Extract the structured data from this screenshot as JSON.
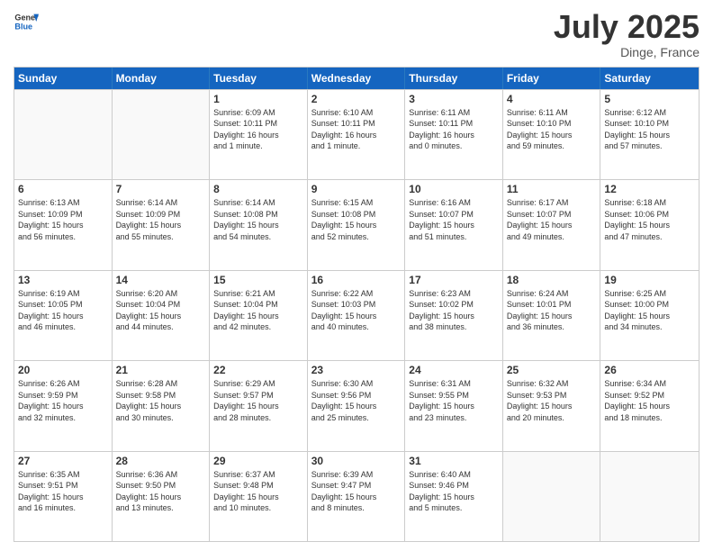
{
  "logo": {
    "line1": "General",
    "line2": "Blue"
  },
  "title": "July 2025",
  "location": "Dinge, France",
  "header_days": [
    "Sunday",
    "Monday",
    "Tuesday",
    "Wednesday",
    "Thursday",
    "Friday",
    "Saturday"
  ],
  "rows": [
    [
      {
        "day": "",
        "lines": []
      },
      {
        "day": "",
        "lines": []
      },
      {
        "day": "1",
        "lines": [
          "Sunrise: 6:09 AM",
          "Sunset: 10:11 PM",
          "Daylight: 16 hours",
          "and 1 minute."
        ]
      },
      {
        "day": "2",
        "lines": [
          "Sunrise: 6:10 AM",
          "Sunset: 10:11 PM",
          "Daylight: 16 hours",
          "and 1 minute."
        ]
      },
      {
        "day": "3",
        "lines": [
          "Sunrise: 6:11 AM",
          "Sunset: 10:11 PM",
          "Daylight: 16 hours",
          "and 0 minutes."
        ]
      },
      {
        "day": "4",
        "lines": [
          "Sunrise: 6:11 AM",
          "Sunset: 10:10 PM",
          "Daylight: 15 hours",
          "and 59 minutes."
        ]
      },
      {
        "day": "5",
        "lines": [
          "Sunrise: 6:12 AM",
          "Sunset: 10:10 PM",
          "Daylight: 15 hours",
          "and 57 minutes."
        ]
      }
    ],
    [
      {
        "day": "6",
        "lines": [
          "Sunrise: 6:13 AM",
          "Sunset: 10:09 PM",
          "Daylight: 15 hours",
          "and 56 minutes."
        ]
      },
      {
        "day": "7",
        "lines": [
          "Sunrise: 6:14 AM",
          "Sunset: 10:09 PM",
          "Daylight: 15 hours",
          "and 55 minutes."
        ]
      },
      {
        "day": "8",
        "lines": [
          "Sunrise: 6:14 AM",
          "Sunset: 10:08 PM",
          "Daylight: 15 hours",
          "and 54 minutes."
        ]
      },
      {
        "day": "9",
        "lines": [
          "Sunrise: 6:15 AM",
          "Sunset: 10:08 PM",
          "Daylight: 15 hours",
          "and 52 minutes."
        ]
      },
      {
        "day": "10",
        "lines": [
          "Sunrise: 6:16 AM",
          "Sunset: 10:07 PM",
          "Daylight: 15 hours",
          "and 51 minutes."
        ]
      },
      {
        "day": "11",
        "lines": [
          "Sunrise: 6:17 AM",
          "Sunset: 10:07 PM",
          "Daylight: 15 hours",
          "and 49 minutes."
        ]
      },
      {
        "day": "12",
        "lines": [
          "Sunrise: 6:18 AM",
          "Sunset: 10:06 PM",
          "Daylight: 15 hours",
          "and 47 minutes."
        ]
      }
    ],
    [
      {
        "day": "13",
        "lines": [
          "Sunrise: 6:19 AM",
          "Sunset: 10:05 PM",
          "Daylight: 15 hours",
          "and 46 minutes."
        ]
      },
      {
        "day": "14",
        "lines": [
          "Sunrise: 6:20 AM",
          "Sunset: 10:04 PM",
          "Daylight: 15 hours",
          "and 44 minutes."
        ]
      },
      {
        "day": "15",
        "lines": [
          "Sunrise: 6:21 AM",
          "Sunset: 10:04 PM",
          "Daylight: 15 hours",
          "and 42 minutes."
        ]
      },
      {
        "day": "16",
        "lines": [
          "Sunrise: 6:22 AM",
          "Sunset: 10:03 PM",
          "Daylight: 15 hours",
          "and 40 minutes."
        ]
      },
      {
        "day": "17",
        "lines": [
          "Sunrise: 6:23 AM",
          "Sunset: 10:02 PM",
          "Daylight: 15 hours",
          "and 38 minutes."
        ]
      },
      {
        "day": "18",
        "lines": [
          "Sunrise: 6:24 AM",
          "Sunset: 10:01 PM",
          "Daylight: 15 hours",
          "and 36 minutes."
        ]
      },
      {
        "day": "19",
        "lines": [
          "Sunrise: 6:25 AM",
          "Sunset: 10:00 PM",
          "Daylight: 15 hours",
          "and 34 minutes."
        ]
      }
    ],
    [
      {
        "day": "20",
        "lines": [
          "Sunrise: 6:26 AM",
          "Sunset: 9:59 PM",
          "Daylight: 15 hours",
          "and 32 minutes."
        ]
      },
      {
        "day": "21",
        "lines": [
          "Sunrise: 6:28 AM",
          "Sunset: 9:58 PM",
          "Daylight: 15 hours",
          "and 30 minutes."
        ]
      },
      {
        "day": "22",
        "lines": [
          "Sunrise: 6:29 AM",
          "Sunset: 9:57 PM",
          "Daylight: 15 hours",
          "and 28 minutes."
        ]
      },
      {
        "day": "23",
        "lines": [
          "Sunrise: 6:30 AM",
          "Sunset: 9:56 PM",
          "Daylight: 15 hours",
          "and 25 minutes."
        ]
      },
      {
        "day": "24",
        "lines": [
          "Sunrise: 6:31 AM",
          "Sunset: 9:55 PM",
          "Daylight: 15 hours",
          "and 23 minutes."
        ]
      },
      {
        "day": "25",
        "lines": [
          "Sunrise: 6:32 AM",
          "Sunset: 9:53 PM",
          "Daylight: 15 hours",
          "and 20 minutes."
        ]
      },
      {
        "day": "26",
        "lines": [
          "Sunrise: 6:34 AM",
          "Sunset: 9:52 PM",
          "Daylight: 15 hours",
          "and 18 minutes."
        ]
      }
    ],
    [
      {
        "day": "27",
        "lines": [
          "Sunrise: 6:35 AM",
          "Sunset: 9:51 PM",
          "Daylight: 15 hours",
          "and 16 minutes."
        ]
      },
      {
        "day": "28",
        "lines": [
          "Sunrise: 6:36 AM",
          "Sunset: 9:50 PM",
          "Daylight: 15 hours",
          "and 13 minutes."
        ]
      },
      {
        "day": "29",
        "lines": [
          "Sunrise: 6:37 AM",
          "Sunset: 9:48 PM",
          "Daylight: 15 hours",
          "and 10 minutes."
        ]
      },
      {
        "day": "30",
        "lines": [
          "Sunrise: 6:39 AM",
          "Sunset: 9:47 PM",
          "Daylight: 15 hours",
          "and 8 minutes."
        ]
      },
      {
        "day": "31",
        "lines": [
          "Sunrise: 6:40 AM",
          "Sunset: 9:46 PM",
          "Daylight: 15 hours",
          "and 5 minutes."
        ]
      },
      {
        "day": "",
        "lines": []
      },
      {
        "day": "",
        "lines": []
      }
    ]
  ]
}
